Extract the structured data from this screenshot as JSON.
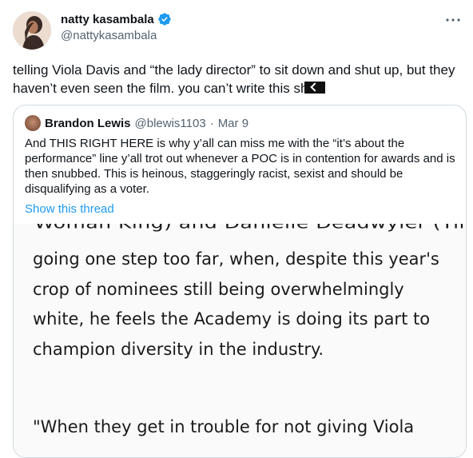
{
  "author": {
    "name": "natty kasambala",
    "handle": "@nattykasambala"
  },
  "tweet_text": "telling Viola Davis and “the lady director” to sit down and shut up, but they haven’t even seen the film. you can’t write this sh",
  "quote": {
    "name": "Brandon Lewis",
    "handle": "@blewis1103",
    "separator": "·",
    "date": "Mar 9",
    "text": "And THIS RIGHT HERE is why y’all can miss me with the “it’s about the performance” line y’all trot out whenever a POC is in contention for awards and is then snubbed. This is heinous, staggeringly racist, sexist and should be disqualifying as a voter.",
    "show_thread": "Show this thread"
  },
  "media": {
    "cut_line": "Woman King) and Danielle Deadwyler (Till) as",
    "article_text": "going one step too far, when, despite this year's crop of nominees still being overwhelmingly white, he feels the Academy is doing its part to champion diversity in the industry.",
    "article_quote": "\"When they get in trouble for not giving Viola"
  },
  "icons": {
    "verified": "verified-badge-icon",
    "more": "more-options-icon"
  },
  "colors": {
    "accent": "#1d9bf0",
    "secondary_text": "#536471",
    "border": "#cfd9de"
  }
}
